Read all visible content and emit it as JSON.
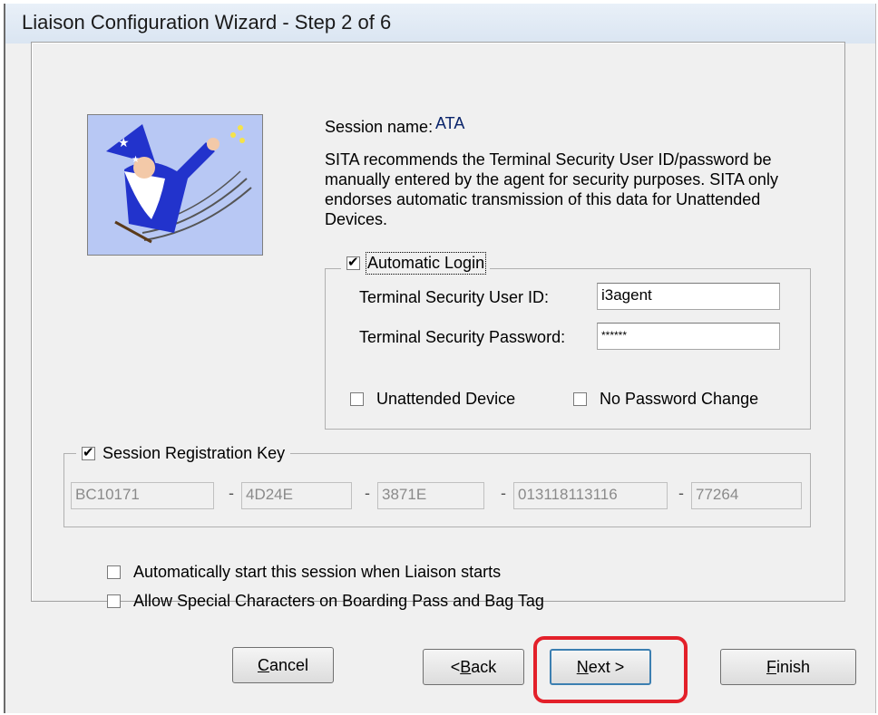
{
  "window": {
    "title": "Liaison Configuration Wizard - Step 2 of 6"
  },
  "session": {
    "name_label": "Session name:",
    "name_value": "ATA",
    "notice": "SITA recommends the Terminal Security User ID/password be manually entered by the agent for security purposes. SITA only endorses automatic transmission of this data for Unattended Devices."
  },
  "auto_login": {
    "label": "Automatic Login",
    "checked": true,
    "user_id_label": "Terminal Security User ID:",
    "user_id_value": "i3agent",
    "password_label": "Terminal Security Password:",
    "password_value": "******",
    "unattended_label": "Unattended Device",
    "unattended_checked": false,
    "no_pw_change_label": "No Password Change",
    "no_pw_change_checked": false
  },
  "registration": {
    "label": "Session Registration Key",
    "checked": true,
    "keys": [
      "BC10171",
      "4D24E",
      "3871E",
      "013118113116",
      "77264"
    ],
    "separator": "-"
  },
  "options": {
    "auto_start_label": "Automatically start this session when Liaison starts",
    "auto_start_checked": false,
    "special_chars_label": "Allow Special Characters on Boarding Pass and Bag Tag",
    "special_chars_checked": false
  },
  "buttons": {
    "cancel_pre": "",
    "cancel_u": "C",
    "cancel_post": "ancel",
    "back_pre": "< ",
    "back_u": "B",
    "back_post": "ack",
    "next_pre": "",
    "next_u": "N",
    "next_post": "ext >",
    "finish_pre": "",
    "finish_u": "F",
    "finish_post": "inish"
  },
  "colors": {
    "highlight": "#e3202a",
    "session_value": "#0a246a"
  },
  "icons": [
    "wizard-image",
    "checkbox-checked",
    "checkbox-unchecked"
  ]
}
